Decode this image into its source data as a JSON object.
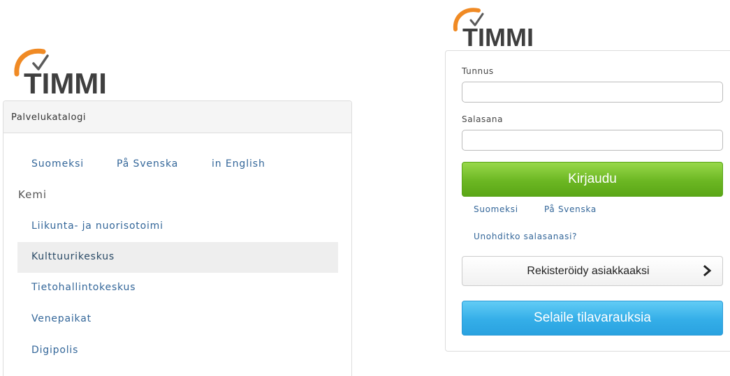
{
  "brand": {
    "name": "TIMMI",
    "text_color": "#3f3f3f",
    "swoosh_color": "#f08a24",
    "check_color": "#5a5a5a"
  },
  "catalog": {
    "title": "Palvelukatalogi",
    "languages": [
      "Suomeksi",
      "På Svenska",
      "in English"
    ],
    "city": "Kemi",
    "items": [
      {
        "label": "Liikunta- ja nuorisotoimi",
        "active": false
      },
      {
        "label": "Kulttuurikeskus",
        "active": true
      },
      {
        "label": "Tietohallintokeskus",
        "active": false
      },
      {
        "label": "Venepaikat",
        "active": false
      },
      {
        "label": "Digipolis",
        "active": false
      }
    ]
  },
  "login": {
    "username_label": "Tunnus",
    "username_value": "",
    "password_label": "Salasana",
    "password_value": "",
    "submit_label": "Kirjaudu",
    "languages": [
      "Suomeksi",
      "På Svenska"
    ],
    "forgot_password": "Unohditko salasanasi?",
    "register_label": "Rekisteröidy asiakkaaksi",
    "register_icon": "chevron-right-icon",
    "browse_label": "Selaile tilavarauksia"
  },
  "colors": {
    "link": "#336699",
    "login_button": "#6cb723",
    "browse_button": "#34aee8",
    "active_item_bg": "#eeeeee"
  }
}
